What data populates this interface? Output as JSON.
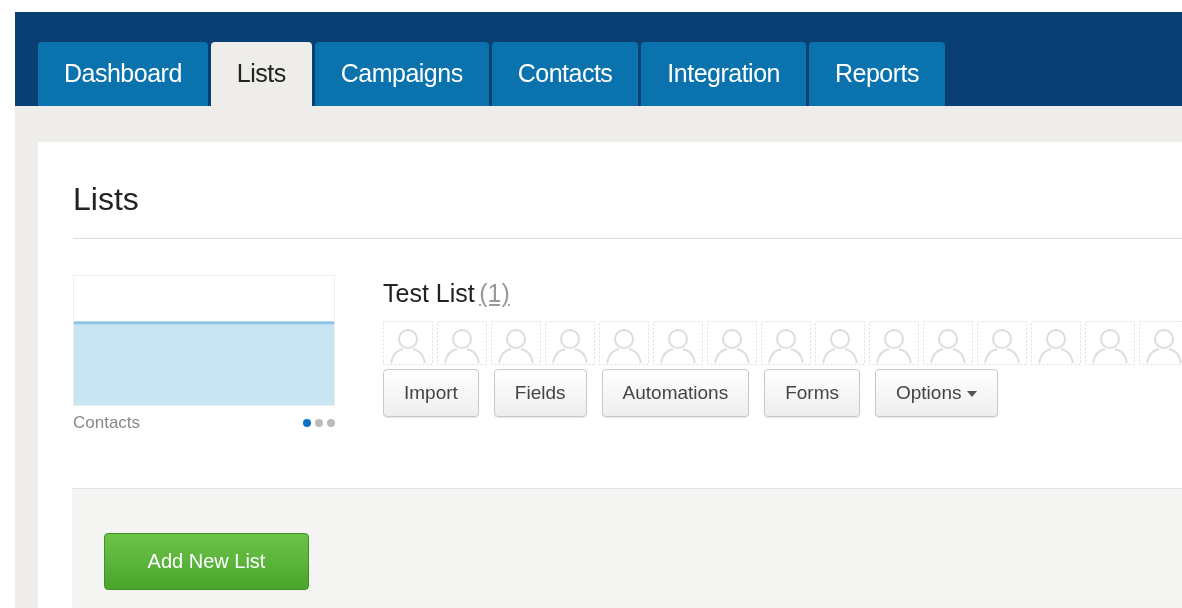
{
  "tabs": [
    {
      "label": "Dashboard",
      "selected": false
    },
    {
      "label": "Lists",
      "selected": true
    },
    {
      "label": "Campaigns",
      "selected": false
    },
    {
      "label": "Contacts",
      "selected": false
    },
    {
      "label": "Integration",
      "selected": false
    },
    {
      "label": "Reports",
      "selected": false
    }
  ],
  "page_title": "Lists",
  "list": {
    "name": "Test List",
    "count": "(1)",
    "thumbnail_label": "Contacts",
    "pager_dots": [
      {
        "selected": true
      },
      {
        "selected": false
      },
      {
        "selected": false
      }
    ],
    "buttons": [
      {
        "label": "Import",
        "kind": "plain"
      },
      {
        "label": "Fields",
        "kind": "plain"
      },
      {
        "label": "Automations",
        "kind": "plain"
      },
      {
        "label": "Forms",
        "kind": "plain"
      },
      {
        "label": "Options",
        "kind": "dropdown"
      }
    ]
  },
  "add_button": "Add New List"
}
